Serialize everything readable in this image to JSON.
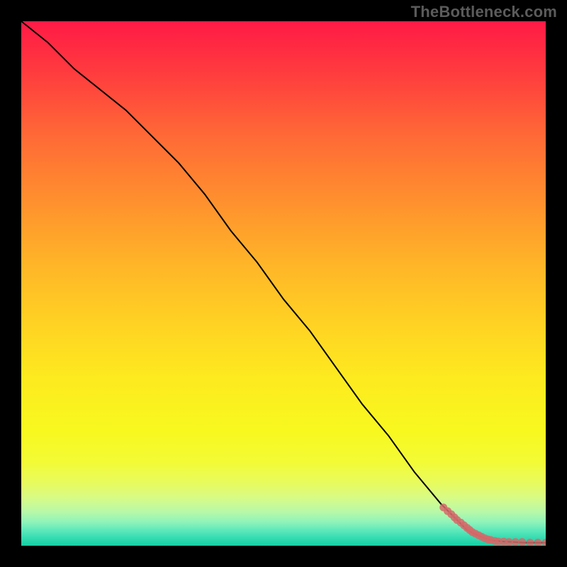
{
  "attribution": "TheBottleneck.com",
  "chart_data": {
    "type": "line",
    "title": "",
    "xlabel": "",
    "ylabel": "",
    "xlim": [
      0,
      100
    ],
    "ylim": [
      0,
      100
    ],
    "series": [
      {
        "name": "curve",
        "style": "line",
        "color": "#000000",
        "x": [
          0,
          5,
          10,
          15,
          20,
          25,
          28,
          30,
          35,
          40,
          45,
          50,
          55,
          60,
          65,
          70,
          75,
          80,
          83,
          85,
          87,
          89,
          90,
          92,
          94,
          96,
          98,
          100
        ],
        "y": [
          100,
          96,
          91,
          87,
          83,
          78,
          75,
          73,
          67,
          60,
          54,
          47,
          41,
          34,
          27,
          21,
          14,
          8,
          5,
          3,
          2,
          1.2,
          1.0,
          0.8,
          0.7,
          0.6,
          0.6,
          0.6
        ]
      },
      {
        "name": "tail-points",
        "style": "scatter",
        "color": "#d46a6a",
        "x": [
          80.5,
          81.3,
          82.0,
          82.6,
          83.1,
          83.8,
          84.4,
          85.0,
          85.5,
          86.0,
          86.6,
          87.2,
          87.8,
          88.4,
          89.0,
          89.5,
          90.3,
          91.0,
          92.0,
          93.0,
          94.2,
          95.5,
          97.0,
          98.5,
          100.0
        ],
        "y": [
          7.3,
          6.6,
          6.0,
          5.4,
          4.9,
          4.4,
          3.9,
          3.4,
          3.0,
          2.6,
          2.3,
          2.0,
          1.7,
          1.4,
          1.2,
          1.1,
          0.9,
          0.8,
          0.8,
          0.7,
          0.7,
          0.7,
          0.6,
          0.6,
          0.6
        ]
      }
    ]
  }
}
